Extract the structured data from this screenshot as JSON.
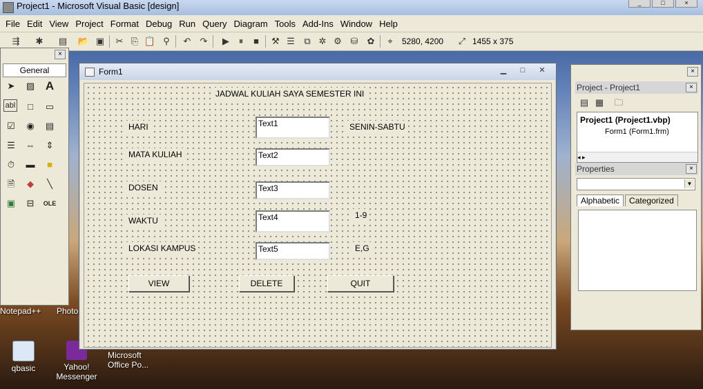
{
  "window": {
    "title": "Project1 - Microsoft Visual Basic [design]"
  },
  "menu": [
    "File",
    "Edit",
    "View",
    "Project",
    "Format",
    "Debug",
    "Run",
    "Query",
    "Diagram",
    "Tools",
    "Add-Ins",
    "Window",
    "Help"
  ],
  "toolbar": {
    "position": "5280, 4200",
    "size": "1455 x 375"
  },
  "toolbox": {
    "tab": "General"
  },
  "form": {
    "title": "Form1",
    "heading": "JADWAL KULIAH SAYA SEMESTER INI",
    "labels": [
      "HARI",
      "MATA KULIAH",
      "DOSEN",
      "WAKTU",
      "LOKASI KAMPUS"
    ],
    "textboxes": [
      "Text1",
      "Text2",
      "Text3",
      "Text4",
      "Text5"
    ],
    "info": [
      "SENIN-SABTU",
      "1-9",
      "E,G"
    ],
    "buttons": [
      "VIEW",
      "DELETE",
      "QUIT"
    ]
  },
  "project_panel": {
    "title": "Project - Project1",
    "root": "Project1 (Project1.vbp)",
    "child": "Form1 (Form1.frm)"
  },
  "properties_panel": {
    "title": "Properties",
    "tabs": [
      "Alphabetic",
      "Categorized"
    ]
  },
  "desktop": {
    "taskbar_labels": [
      "Notepad++",
      "Photo"
    ],
    "icons": [
      "qbasic",
      "Yahoo! Messenger",
      "Microsoft Office Po..."
    ]
  }
}
